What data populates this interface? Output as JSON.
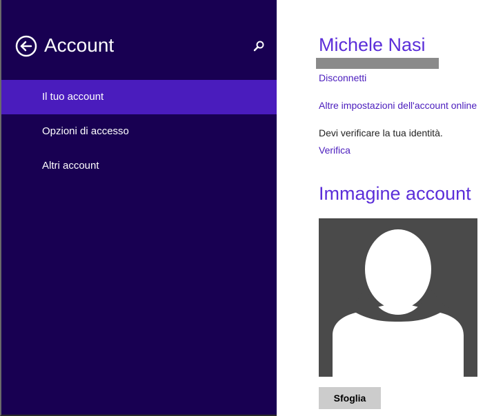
{
  "colors": {
    "sidebar_background": "#180052",
    "selected_item": "#4a1cbd",
    "accent": "#5b2ed9",
    "link": "#4a1cbd",
    "avatar_background": "#4a4a4a",
    "button_background": "#cccccc"
  },
  "sidebar": {
    "back_icon": "back-arrow-circle-icon",
    "title": "Account",
    "search_icon": "search-icon",
    "items": [
      {
        "label": "Il tuo account",
        "selected": true
      },
      {
        "label": "Opzioni di accesso",
        "selected": false
      },
      {
        "label": "Altri account",
        "selected": false
      }
    ]
  },
  "account": {
    "user_name": "Michele Nasi",
    "email_redacted": true,
    "disconnect_link": "Disconnetti",
    "online_settings_link": "Altre impostazioni dell'account online",
    "verify_message": "Devi verificare la tua identità.",
    "verify_link": "Verifica"
  },
  "picture": {
    "title": "Immagine account",
    "avatar_icon": "default-user-silhouette-icon",
    "browse_label": "Sfoglia"
  }
}
